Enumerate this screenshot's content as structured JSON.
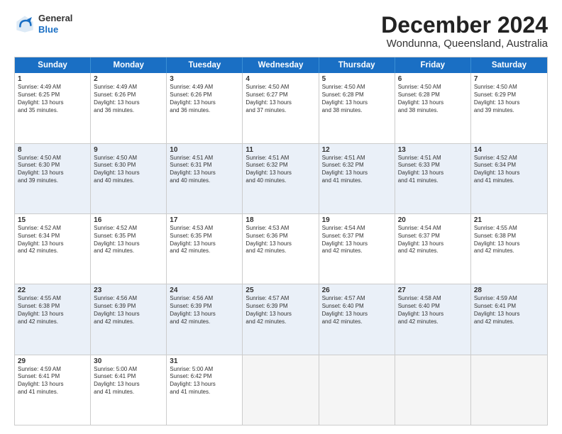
{
  "logo": {
    "general": "General",
    "blue": "Blue"
  },
  "header": {
    "month": "December 2024",
    "location": "Wondunna, Queensland, Australia"
  },
  "weekdays": [
    "Sunday",
    "Monday",
    "Tuesday",
    "Wednesday",
    "Thursday",
    "Friday",
    "Saturday"
  ],
  "rows": [
    {
      "alt": false,
      "cells": [
        {
          "day": "1",
          "lines": [
            "Sunrise: 4:49 AM",
            "Sunset: 6:25 PM",
            "Daylight: 13 hours",
            "and 35 minutes."
          ],
          "empty": false
        },
        {
          "day": "2",
          "lines": [
            "Sunrise: 4:49 AM",
            "Sunset: 6:26 PM",
            "Daylight: 13 hours",
            "and 36 minutes."
          ],
          "empty": false
        },
        {
          "day": "3",
          "lines": [
            "Sunrise: 4:49 AM",
            "Sunset: 6:26 PM",
            "Daylight: 13 hours",
            "and 36 minutes."
          ],
          "empty": false
        },
        {
          "day": "4",
          "lines": [
            "Sunrise: 4:50 AM",
            "Sunset: 6:27 PM",
            "Daylight: 13 hours",
            "and 37 minutes."
          ],
          "empty": false
        },
        {
          "day": "5",
          "lines": [
            "Sunrise: 4:50 AM",
            "Sunset: 6:28 PM",
            "Daylight: 13 hours",
            "and 38 minutes."
          ],
          "empty": false
        },
        {
          "day": "6",
          "lines": [
            "Sunrise: 4:50 AM",
            "Sunset: 6:28 PM",
            "Daylight: 13 hours",
            "and 38 minutes."
          ],
          "empty": false
        },
        {
          "day": "7",
          "lines": [
            "Sunrise: 4:50 AM",
            "Sunset: 6:29 PM",
            "Daylight: 13 hours",
            "and 39 minutes."
          ],
          "empty": false
        }
      ]
    },
    {
      "alt": true,
      "cells": [
        {
          "day": "8",
          "lines": [
            "Sunrise: 4:50 AM",
            "Sunset: 6:30 PM",
            "Daylight: 13 hours",
            "and 39 minutes."
          ],
          "empty": false
        },
        {
          "day": "9",
          "lines": [
            "Sunrise: 4:50 AM",
            "Sunset: 6:30 PM",
            "Daylight: 13 hours",
            "and 40 minutes."
          ],
          "empty": false
        },
        {
          "day": "10",
          "lines": [
            "Sunrise: 4:51 AM",
            "Sunset: 6:31 PM",
            "Daylight: 13 hours",
            "and 40 minutes."
          ],
          "empty": false
        },
        {
          "day": "11",
          "lines": [
            "Sunrise: 4:51 AM",
            "Sunset: 6:32 PM",
            "Daylight: 13 hours",
            "and 40 minutes."
          ],
          "empty": false
        },
        {
          "day": "12",
          "lines": [
            "Sunrise: 4:51 AM",
            "Sunset: 6:32 PM",
            "Daylight: 13 hours",
            "and 41 minutes."
          ],
          "empty": false
        },
        {
          "day": "13",
          "lines": [
            "Sunrise: 4:51 AM",
            "Sunset: 6:33 PM",
            "Daylight: 13 hours",
            "and 41 minutes."
          ],
          "empty": false
        },
        {
          "day": "14",
          "lines": [
            "Sunrise: 4:52 AM",
            "Sunset: 6:34 PM",
            "Daylight: 13 hours",
            "and 41 minutes."
          ],
          "empty": false
        }
      ]
    },
    {
      "alt": false,
      "cells": [
        {
          "day": "15",
          "lines": [
            "Sunrise: 4:52 AM",
            "Sunset: 6:34 PM",
            "Daylight: 13 hours",
            "and 42 minutes."
          ],
          "empty": false
        },
        {
          "day": "16",
          "lines": [
            "Sunrise: 4:52 AM",
            "Sunset: 6:35 PM",
            "Daylight: 13 hours",
            "and 42 minutes."
          ],
          "empty": false
        },
        {
          "day": "17",
          "lines": [
            "Sunrise: 4:53 AM",
            "Sunset: 6:35 PM",
            "Daylight: 13 hours",
            "and 42 minutes."
          ],
          "empty": false
        },
        {
          "day": "18",
          "lines": [
            "Sunrise: 4:53 AM",
            "Sunset: 6:36 PM",
            "Daylight: 13 hours",
            "and 42 minutes."
          ],
          "empty": false
        },
        {
          "day": "19",
          "lines": [
            "Sunrise: 4:54 AM",
            "Sunset: 6:37 PM",
            "Daylight: 13 hours",
            "and 42 minutes."
          ],
          "empty": false
        },
        {
          "day": "20",
          "lines": [
            "Sunrise: 4:54 AM",
            "Sunset: 6:37 PM",
            "Daylight: 13 hours",
            "and 42 minutes."
          ],
          "empty": false
        },
        {
          "day": "21",
          "lines": [
            "Sunrise: 4:55 AM",
            "Sunset: 6:38 PM",
            "Daylight: 13 hours",
            "and 42 minutes."
          ],
          "empty": false
        }
      ]
    },
    {
      "alt": true,
      "cells": [
        {
          "day": "22",
          "lines": [
            "Sunrise: 4:55 AM",
            "Sunset: 6:38 PM",
            "Daylight: 13 hours",
            "and 42 minutes."
          ],
          "empty": false
        },
        {
          "day": "23",
          "lines": [
            "Sunrise: 4:56 AM",
            "Sunset: 6:39 PM",
            "Daylight: 13 hours",
            "and 42 minutes."
          ],
          "empty": false
        },
        {
          "day": "24",
          "lines": [
            "Sunrise: 4:56 AM",
            "Sunset: 6:39 PM",
            "Daylight: 13 hours",
            "and 42 minutes."
          ],
          "empty": false
        },
        {
          "day": "25",
          "lines": [
            "Sunrise: 4:57 AM",
            "Sunset: 6:39 PM",
            "Daylight: 13 hours",
            "and 42 minutes."
          ],
          "empty": false
        },
        {
          "day": "26",
          "lines": [
            "Sunrise: 4:57 AM",
            "Sunset: 6:40 PM",
            "Daylight: 13 hours",
            "and 42 minutes."
          ],
          "empty": false
        },
        {
          "day": "27",
          "lines": [
            "Sunrise: 4:58 AM",
            "Sunset: 6:40 PM",
            "Daylight: 13 hours",
            "and 42 minutes."
          ],
          "empty": false
        },
        {
          "day": "28",
          "lines": [
            "Sunrise: 4:59 AM",
            "Sunset: 6:41 PM",
            "Daylight: 13 hours",
            "and 42 minutes."
          ],
          "empty": false
        }
      ]
    },
    {
      "alt": false,
      "cells": [
        {
          "day": "29",
          "lines": [
            "Sunrise: 4:59 AM",
            "Sunset: 6:41 PM",
            "Daylight: 13 hours",
            "and 41 minutes."
          ],
          "empty": false
        },
        {
          "day": "30",
          "lines": [
            "Sunrise: 5:00 AM",
            "Sunset: 6:41 PM",
            "Daylight: 13 hours",
            "and 41 minutes."
          ],
          "empty": false
        },
        {
          "day": "31",
          "lines": [
            "Sunrise: 5:00 AM",
            "Sunset: 6:42 PM",
            "Daylight: 13 hours",
            "and 41 minutes."
          ],
          "empty": false
        },
        {
          "day": "",
          "lines": [],
          "empty": true
        },
        {
          "day": "",
          "lines": [],
          "empty": true
        },
        {
          "day": "",
          "lines": [],
          "empty": true
        },
        {
          "day": "",
          "lines": [],
          "empty": true
        }
      ]
    }
  ]
}
